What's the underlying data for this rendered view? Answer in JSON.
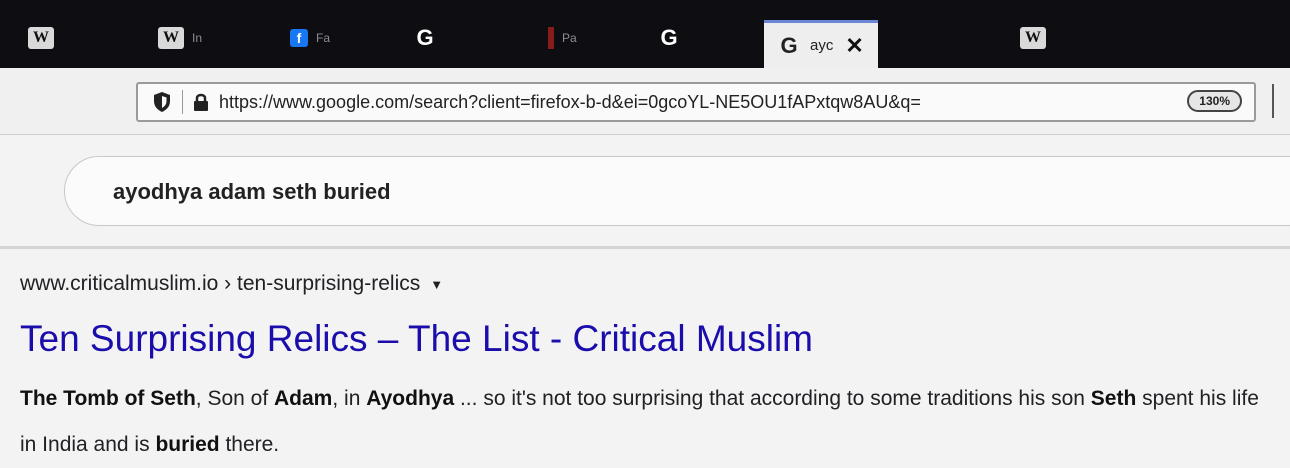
{
  "tabs": [
    {
      "icon": "W",
      "type": "w"
    },
    {
      "icon": "W",
      "type": "w",
      "label": "In"
    },
    {
      "icon": "f",
      "type": "f",
      "label": "Fa"
    },
    {
      "icon": "G",
      "type": "g"
    },
    {
      "icon": "",
      "type": "p",
      "label": "Pa"
    },
    {
      "icon": "G",
      "type": "g"
    },
    {
      "icon": "G",
      "type": "g",
      "label": "ayc",
      "active": true
    },
    {
      "icon": "W",
      "type": "w"
    }
  ],
  "toolbar": {
    "url": "https://www.google.com/search?client=firefox-b-d&ei=0gcoYL-NE5OU1fAPxtqw8AU&q=",
    "zoom": "130%"
  },
  "search": {
    "query": "ayodhya adam seth buried"
  },
  "result": {
    "url": "www.criticalmuslim.io › ten-surprising-relics",
    "title": "Ten Surprising Relics – The List - Critical Muslim",
    "snippet_parts": [
      {
        "t": "The Tomb of ",
        "b": true
      },
      {
        "t": "Seth",
        "b": true
      },
      {
        "t": ", Son of ",
        "b": false
      },
      {
        "t": "Adam",
        "b": true
      },
      {
        "t": ", in ",
        "b": false
      },
      {
        "t": "Ayodhya",
        "b": true
      },
      {
        "t": " ... so it's not too surprising that according to some traditions his son ",
        "b": false
      },
      {
        "t": "Seth",
        "b": true
      },
      {
        "t": " spent his life in India and is ",
        "b": false
      },
      {
        "t": "buried",
        "b": true
      },
      {
        "t": " there.",
        "b": false
      }
    ]
  }
}
